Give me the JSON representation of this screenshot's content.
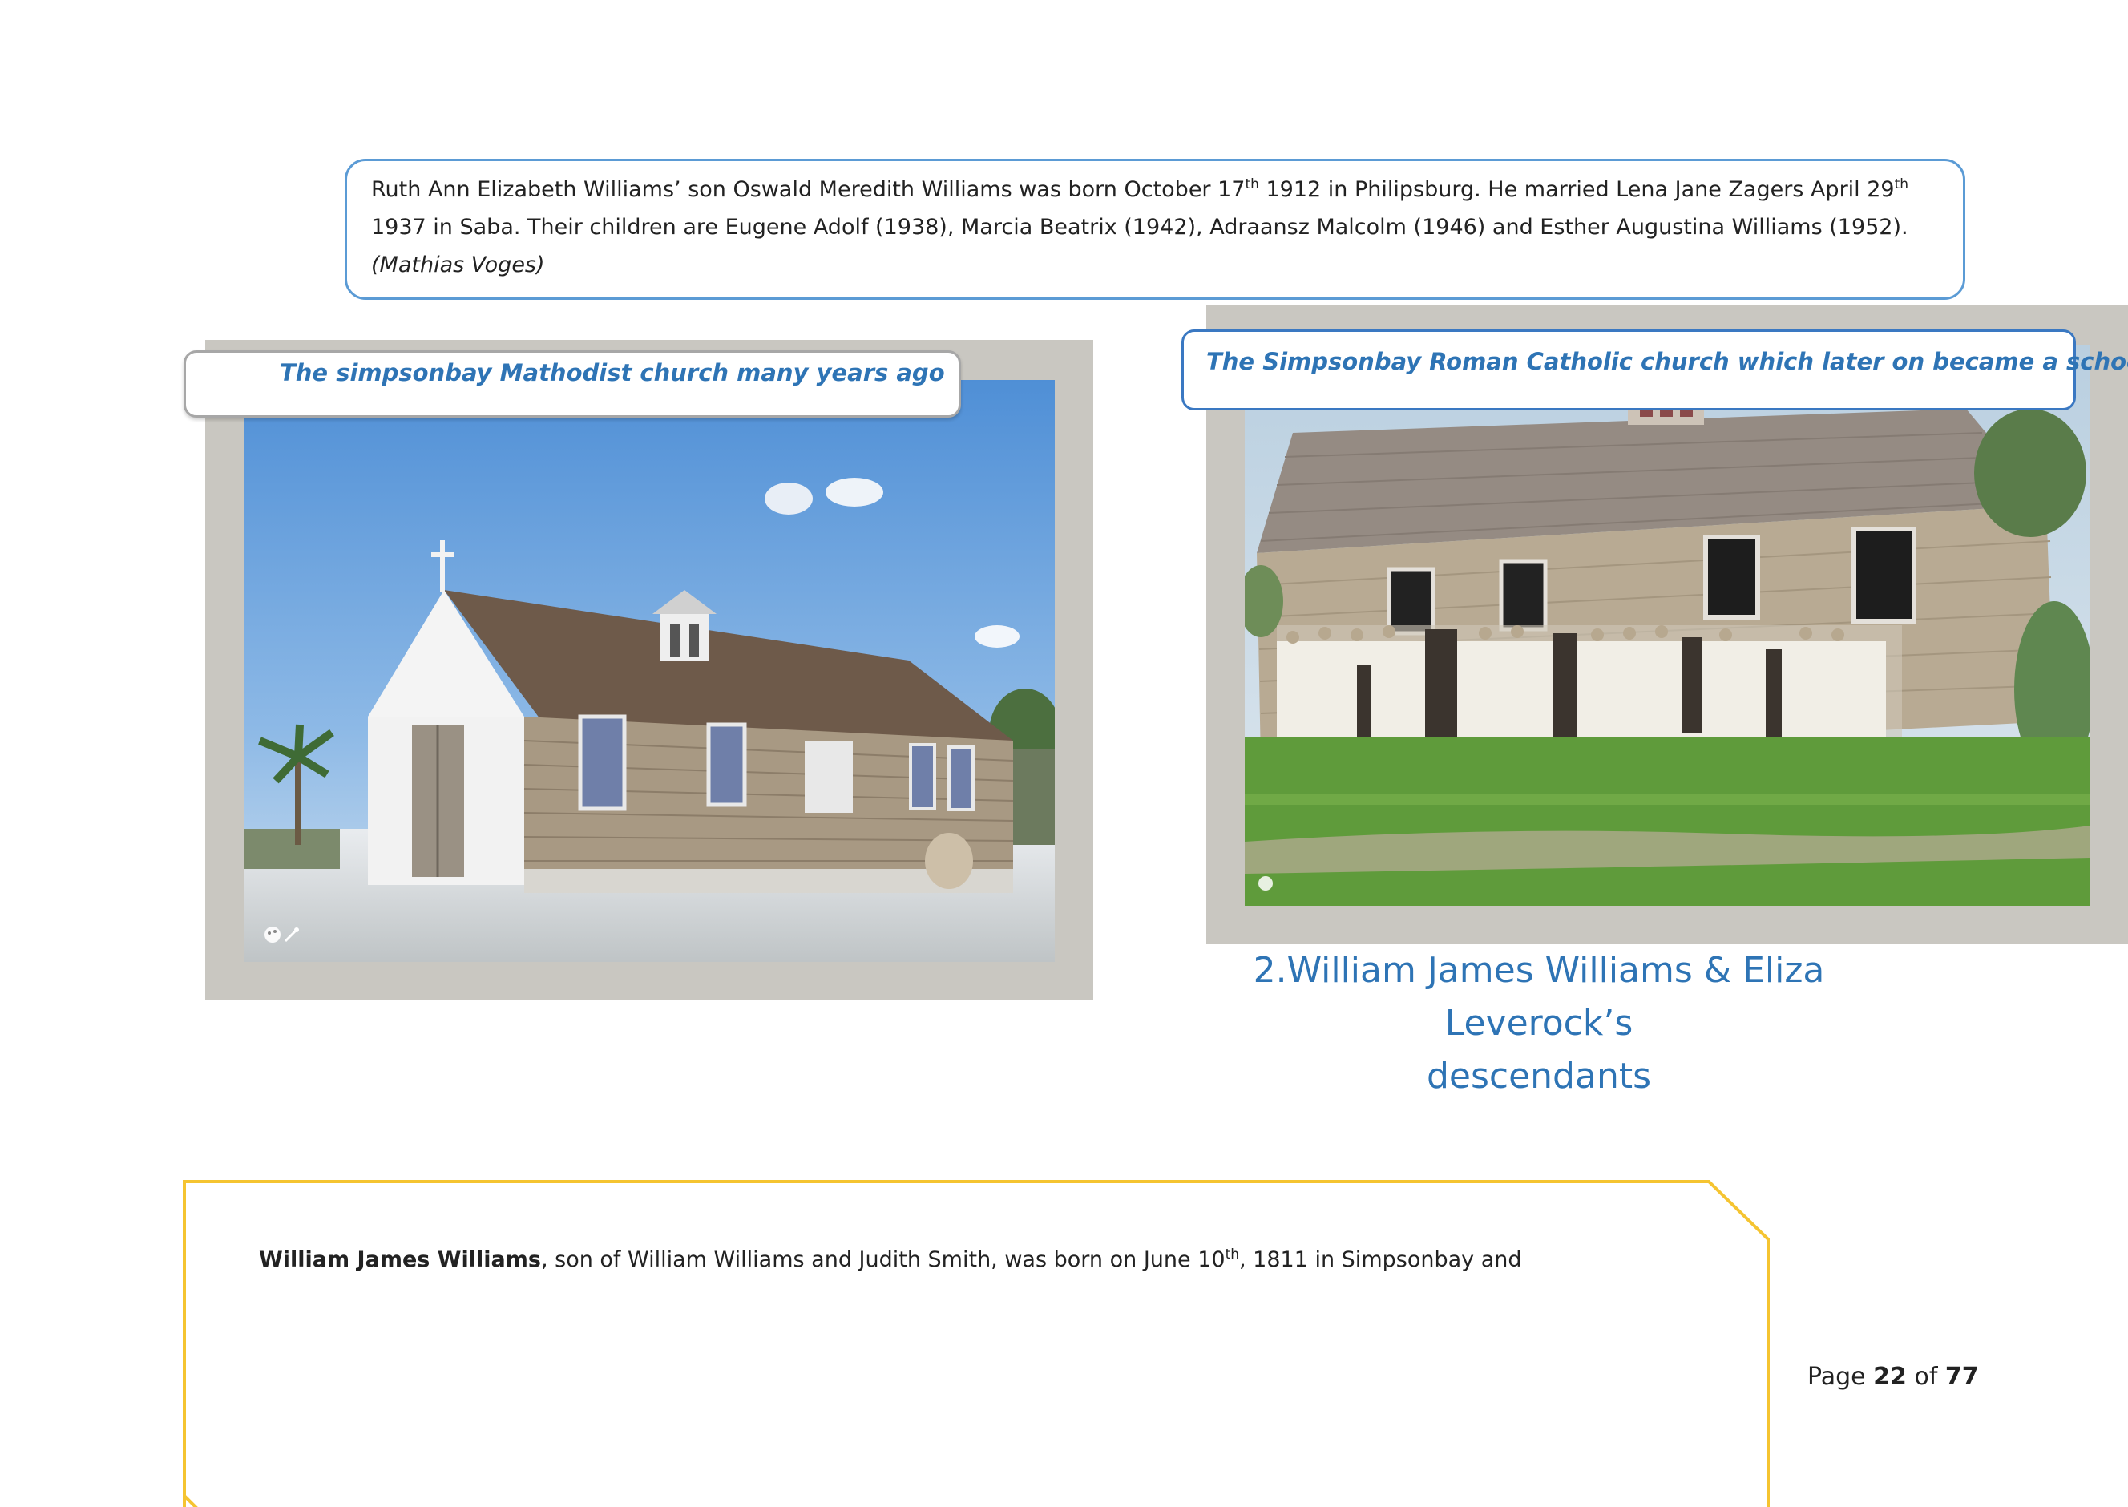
{
  "intro": {
    "t1": "Ruth Ann Elizabeth Williams’ son Oswald Meredith Williams was born October 17",
    "s1": "th",
    "t2": " 1912 in Philipsburg. He married Lena Jane Zagers April 29",
    "s2": "th",
    "t3": " 1937 in Saba. Their children are Eugene Adolf (1938), Marcia Beatrix (1942), Adraansz Malcolm (1946) and Esther Augustina Williams (1952). ",
    "source": "(Mathias Voges)"
  },
  "photos": {
    "left_caption": "The simpsonbay Mathodist church many years ago",
    "right_caption": "The  Simpsonbay Roman Catholic church which later on became a  school"
  },
  "section_heading": {
    "line1": "2.William James Williams & Eliza Leverock’s",
    "line2": "descendants"
  },
  "body": {
    "bold_name": "William James Williams",
    "t1": ", son of William Williams and Judith Smith, was born on June 10",
    "s1": "th",
    "t2": ", 1811 in Simpsonbay and"
  },
  "footer": {
    "page_prefix": "Page ",
    "page_current": "22",
    "page_of": " of ",
    "page_total": "77"
  },
  "colors": {
    "accent_blue": "#2e74b5",
    "box_border_blue": "#5b9bd5",
    "frame_yellow": "#f5c431",
    "photo_frame_gray": "#c9c7c1"
  },
  "icons": [
    "palette-icon",
    "magic-wand-icon"
  ]
}
